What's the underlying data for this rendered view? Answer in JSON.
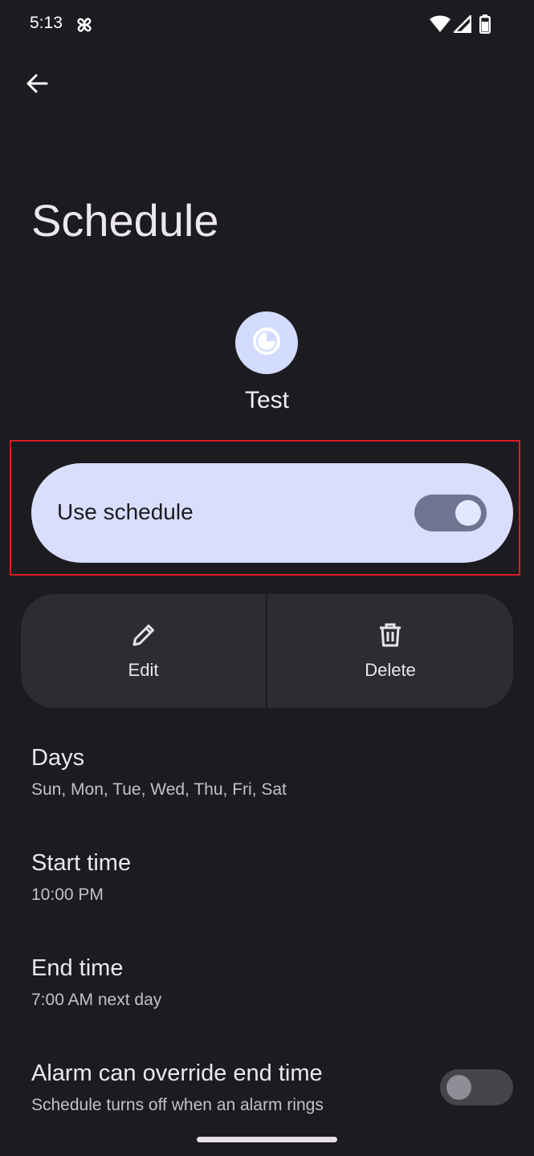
{
  "status_bar": {
    "time": "5:13",
    "app_icon": "pinwheel-icon",
    "wifi_icon": "wifi-icon",
    "signal_icon": "signal-icon",
    "battery_icon": "battery-icon"
  },
  "nav": {
    "back_icon": "arrow-back-icon"
  },
  "page": {
    "title": "Schedule"
  },
  "mode": {
    "name": "Test",
    "icon": "clock-moon-icon"
  },
  "use_schedule": {
    "label": "Use schedule",
    "checked": true
  },
  "actions": [
    {
      "label": "Edit",
      "icon": "pencil-icon"
    },
    {
      "label": "Delete",
      "icon": "trash-icon"
    }
  ],
  "settings": [
    {
      "title": "Days",
      "summary": "Sun, Mon, Tue, Wed, Thu, Fri, Sat"
    },
    {
      "title": "Start time",
      "summary": "10:00 PM"
    },
    {
      "title": "End time",
      "summary": "7:00 AM next day"
    },
    {
      "title": "Alarm can override end time",
      "summary": "Schedule turns off when an alarm rings",
      "checked": false
    }
  ],
  "colors": {
    "background": "#1c1b20",
    "card_primary": "#d8defc",
    "card_secondary": "#2d2c33",
    "highlight": "#e01a22"
  }
}
